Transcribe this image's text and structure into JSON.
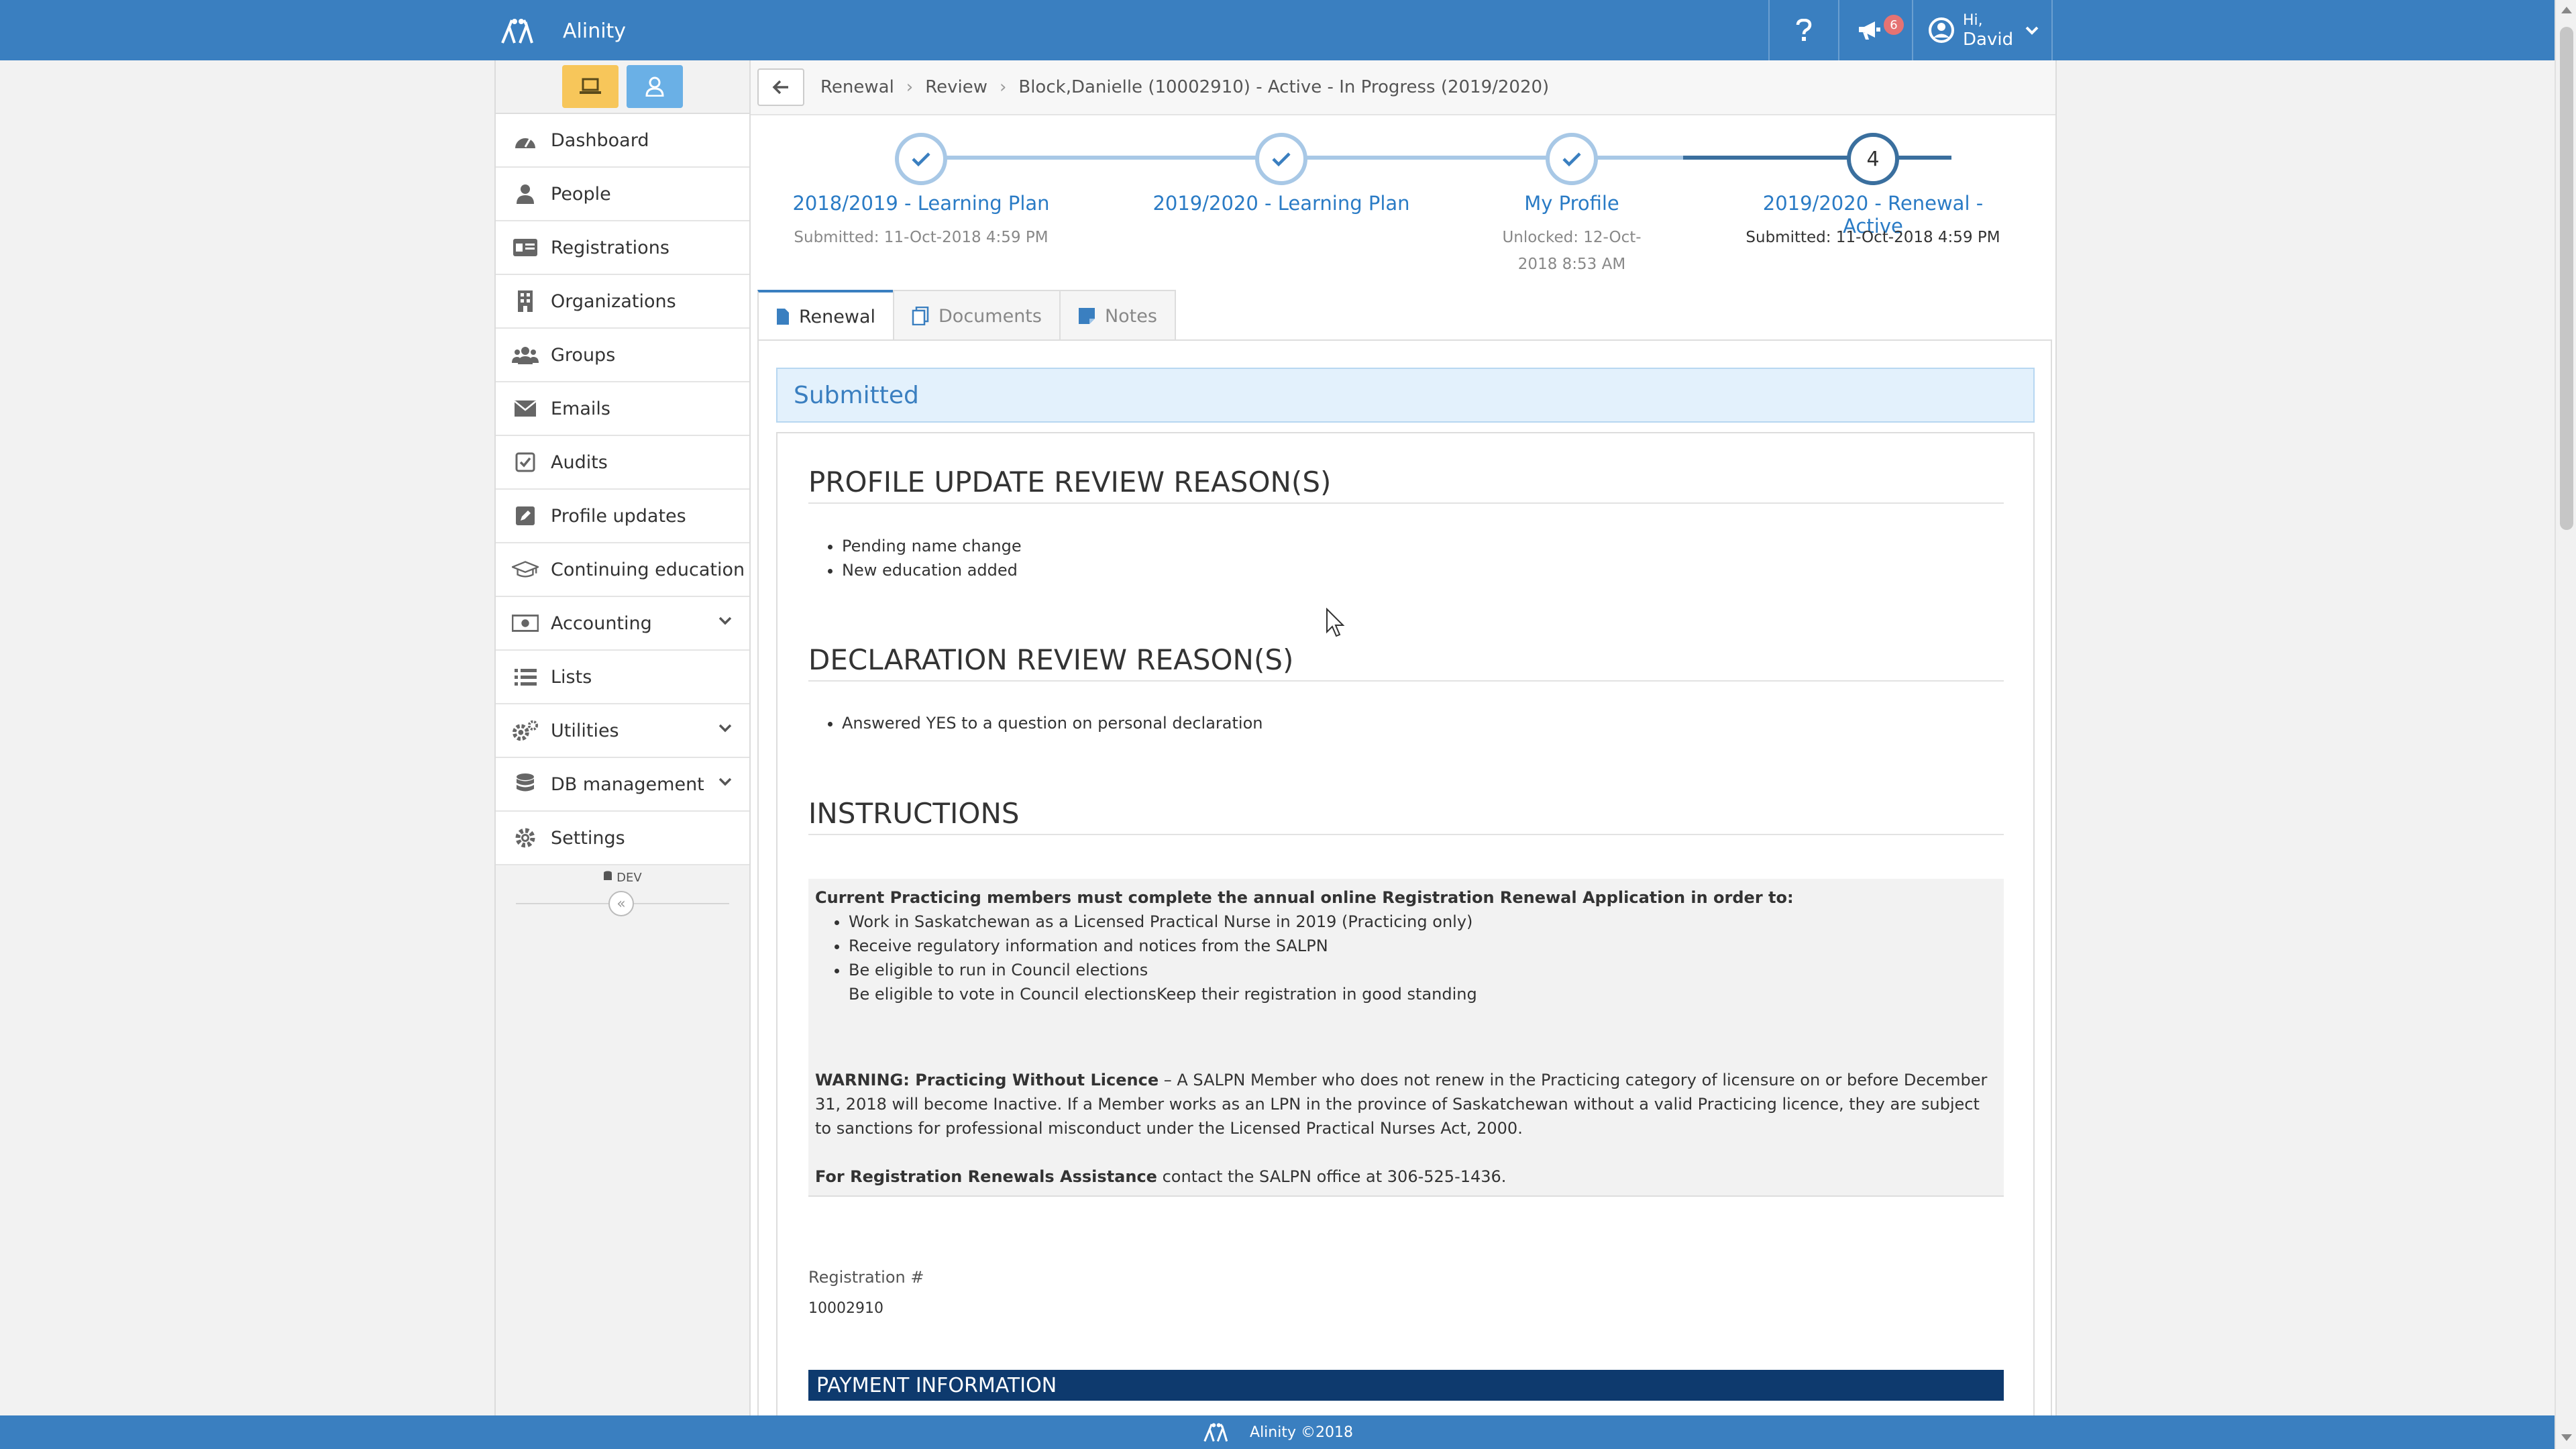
{
  "app": {
    "name": "Alinity"
  },
  "header": {
    "notifications_count": "6",
    "greeting": "Hi,",
    "user_name": "David"
  },
  "sidebar": {
    "items": [
      {
        "label": "Dashboard",
        "icon": "dashboard-icon"
      },
      {
        "label": "People",
        "icon": "person-icon"
      },
      {
        "label": "Registrations",
        "icon": "id-card-icon"
      },
      {
        "label": "Organizations",
        "icon": "building-icon"
      },
      {
        "label": "Groups",
        "icon": "users-icon"
      },
      {
        "label": "Emails",
        "icon": "envelope-icon"
      },
      {
        "label": "Audits",
        "icon": "check-square-icon"
      },
      {
        "label": "Profile updates",
        "icon": "edit-icon"
      },
      {
        "label": "Continuing education",
        "icon": "graduation-cap-icon"
      },
      {
        "label": "Accounting",
        "icon": "money-icon"
      },
      {
        "label": "Lists",
        "icon": "list-icon"
      },
      {
        "label": "Utilities",
        "icon": "cogs-icon"
      },
      {
        "label": "DB management",
        "icon": "database-icon"
      },
      {
        "label": "Settings",
        "icon": "gear-icon"
      }
    ],
    "dev_label": "DEV"
  },
  "breadcrumb": {
    "items": [
      "Renewal",
      "Review",
      "Block,Danielle (10002910) - Active - In Progress (2019/2020)"
    ]
  },
  "stepper": {
    "steps": [
      {
        "title": "2018/2019 - Learning Plan",
        "sub": "Submitted: 11-Oct-2018 4:59 PM",
        "state": "done"
      },
      {
        "title": "2019/2020 - Learning Plan",
        "sub": "",
        "state": "done"
      },
      {
        "title": "My Profile",
        "sub": "Unlocked: 12-Oct-2018 8:53 AM",
        "state": "done"
      },
      {
        "title": "2019/2020 - Renewal - Active",
        "sub": "Submitted: 11-Oct-2018 4:59 PM",
        "state": "active",
        "number": "4"
      }
    ]
  },
  "tabs": [
    {
      "label": "Renewal",
      "active": true
    },
    {
      "label": "Documents",
      "active": false
    },
    {
      "label": "Notes",
      "active": false
    }
  ],
  "status": {
    "label": "Submitted"
  },
  "sections": {
    "profile_update": {
      "heading": "PROFILE UPDATE REVIEW REASON(S)",
      "reasons": [
        "Pending name change",
        "New education added"
      ]
    },
    "declaration": {
      "heading": "DECLARATION REVIEW REASON(S)",
      "reasons": [
        "Answered YES to a question on personal declaration"
      ]
    },
    "instructions": {
      "heading": "INSTRUCTIONS",
      "intro": "Current Practicing members must complete the annual online Registration Renewal Application in order to:",
      "bullets": [
        "Work in Saskatchewan as a Licensed Practical Nurse in 2019 (Practicing only)",
        "Receive regulatory information and notices from the SALPN",
        "Be eligible to run in Council elections"
      ],
      "bullet_cont": "Be eligible to vote in Council electionsKeep their registration in good standing",
      "warning_label": "WARNING: Practicing Without Licence",
      "warning_text": " – A SALPN Member who does not renew in the Practicing category of licensure on or before December 31, 2018 will become Inactive. If a Member works as an LPN in the province of Saskatchewan without a valid Practicing licence, they are subject to sanctions for professional misconduct under the Licensed Practical Nurses Act, 2000.",
      "assist_label": "For Registration Renewals Assistance",
      "assist_text": " contact the SALPN office at 306-525-1436."
    }
  },
  "registration": {
    "label": "Registration #",
    "value": "10002910"
  },
  "payment": {
    "heading": "PAYMENT INFORMATION"
  },
  "footer": {
    "text": "Alinity ©2018"
  },
  "colors": {
    "primary": "#3a7fc0",
    "navy": "#0e3a6e",
    "step_done": "#a8c8e6",
    "step_active": "#3a6f9e"
  }
}
